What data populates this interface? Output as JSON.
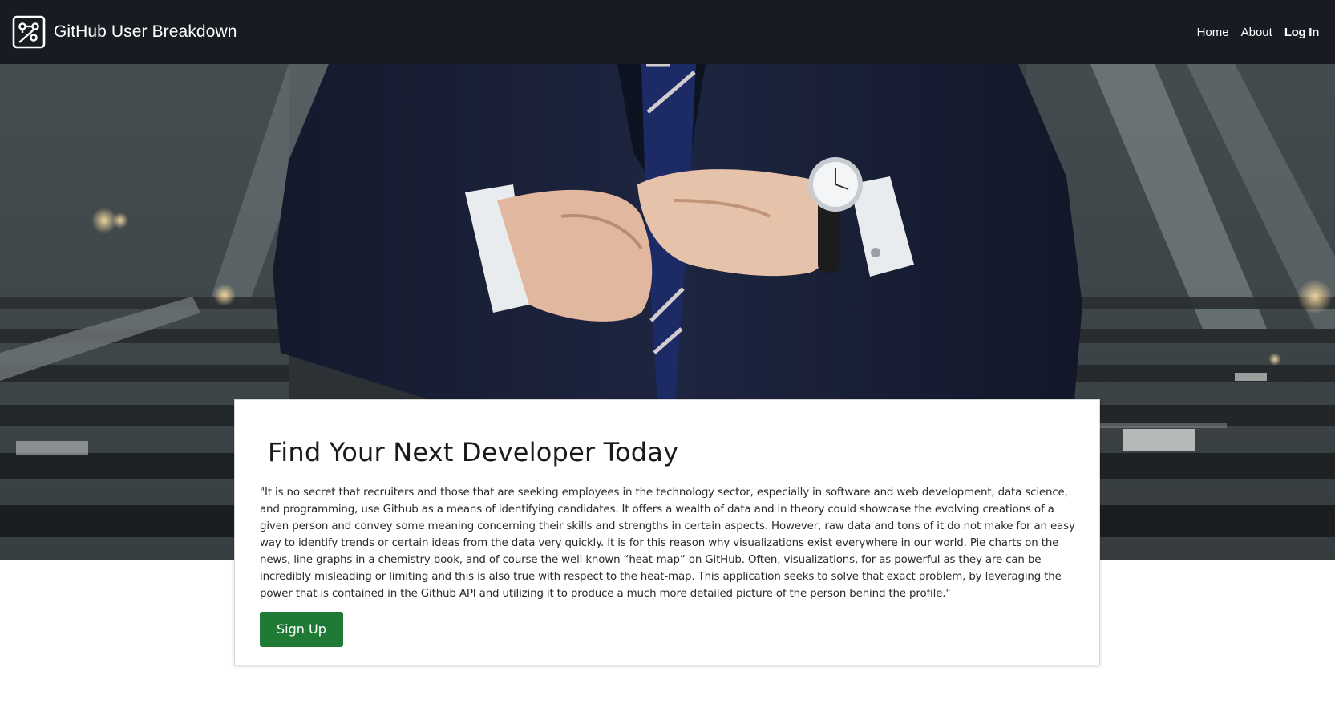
{
  "navbar": {
    "brand_icon": "network-graph-icon",
    "brand_title": "GitHub User Breakdown",
    "links": [
      {
        "label": "Home"
      },
      {
        "label": "About"
      },
      {
        "label": "Log In"
      }
    ]
  },
  "hero": {
    "image": "businessman-buttoning-suit-jacket-on-stairs"
  },
  "card": {
    "title": "Find Your Next Developer Today",
    "body": "\"It is no secret that recruiters and those that are seeking employees in the technology sector, especially in software and web development, data science, and programming, use Github as a means of identifying candidates. It offers a wealth of data and in theory could showcase the evolving creations of a given person and convey some meaning concerning their skills and strengths in certain aspects. However, raw data and tons of it do not make for an easy way to identify trends or certain ideas from the data very quickly. It is for this reason why visualizations exist everywhere in our world. Pie charts on the news, line graphs in a chemistry book, and of course the well known “heat-map” on GitHub. Often, visualizations, for as powerful as they are can be incredibly misleading or limiting and this is also true with respect to the heat-map. This application seeks to solve that exact problem, by leveraging the power that is contained in the Github API and utilizing it to produce a much more detailed picture of the person behind the profile.\"",
    "cta_label": "Sign Up"
  },
  "colors": {
    "navbar_bg": "#181b21",
    "cta_bg": "#1f7a36"
  }
}
